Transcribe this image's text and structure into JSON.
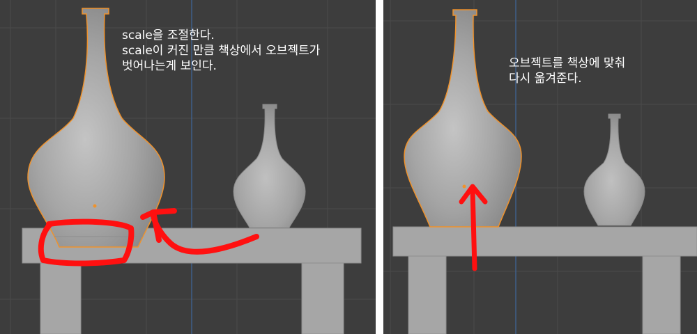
{
  "panels": {
    "left": {
      "caption": [
        "scale을 조절한다.",
        "scale이 커진 만큼 책상에서 오브젝트가",
        "벗어나는게 보인다."
      ]
    },
    "right": {
      "caption": [
        "오브젝트를 책상에 맞춰",
        "다시 옮겨준다."
      ]
    }
  },
  "colors": {
    "viewport_background": "#3d3d3d",
    "grid_line": "#4d4d4d",
    "grid_axis_blue": "#3f5f8a",
    "table": "#a6a6a6",
    "vase": "#a9a9a9",
    "selection_outline": "#f0922b",
    "origin_dot": "#f0922b",
    "annotation_red": "#ff1010",
    "caption_text": "#ffffff",
    "separator": "#ffffff"
  }
}
